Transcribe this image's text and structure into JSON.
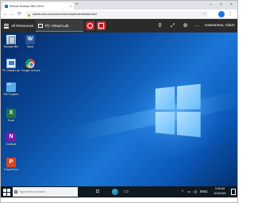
{
  "browser": {
    "tab_title": "Remote Desktop Web Client",
    "tab_close": "×",
    "new_tab": "+",
    "window_controls": {
      "minimize": "–",
      "maximize": "□",
      "close": "×"
    },
    "nav": {
      "back": "←",
      "forward": "→",
      "reload": "⟳"
    },
    "url": "rdweb.wvd.microsoft.com/arm/webclient/index.html",
    "star": "☆",
    "menu": "⋮"
  },
  "rd_toolbar": {
    "home_label": "All Resources",
    "session_label": "PC Virtual Lab",
    "user_name": "Hassaneea, Adam",
    "icons": {
      "pin": "⚲",
      "expand": "⤢",
      "settings": "⚙",
      "more": "···"
    }
  },
  "desktop": {
    "icons": [
      {
        "label": "Recycle Bin",
        "icon": "recycle-bin-icon"
      },
      {
        "label": "Word",
        "icon": "word-icon"
      },
      {
        "label": "PC Virtual Lab",
        "icon": "remote-desktop-icon"
      },
      {
        "label": "Google Chrome",
        "icon": "chrome-icon"
      },
      {
        "label": "File Explorer",
        "icon": "folder-icon"
      },
      {
        "label": "Excel",
        "icon": "excel-icon"
      },
      {
        "label": "OneNote",
        "icon": "onenote-icon"
      },
      {
        "label": "PowerPoint",
        "icon": "powerpoint-icon"
      }
    ]
  },
  "taskbar": {
    "search_placeholder": "Type here to search",
    "task_view": "⊡",
    "explorer": "▭",
    "tray": {
      "chevron": "^",
      "network": "▭",
      "volume": "◁)",
      "lang": "ENG"
    },
    "time": "3:05 AM",
    "date": "3/13/2020"
  }
}
